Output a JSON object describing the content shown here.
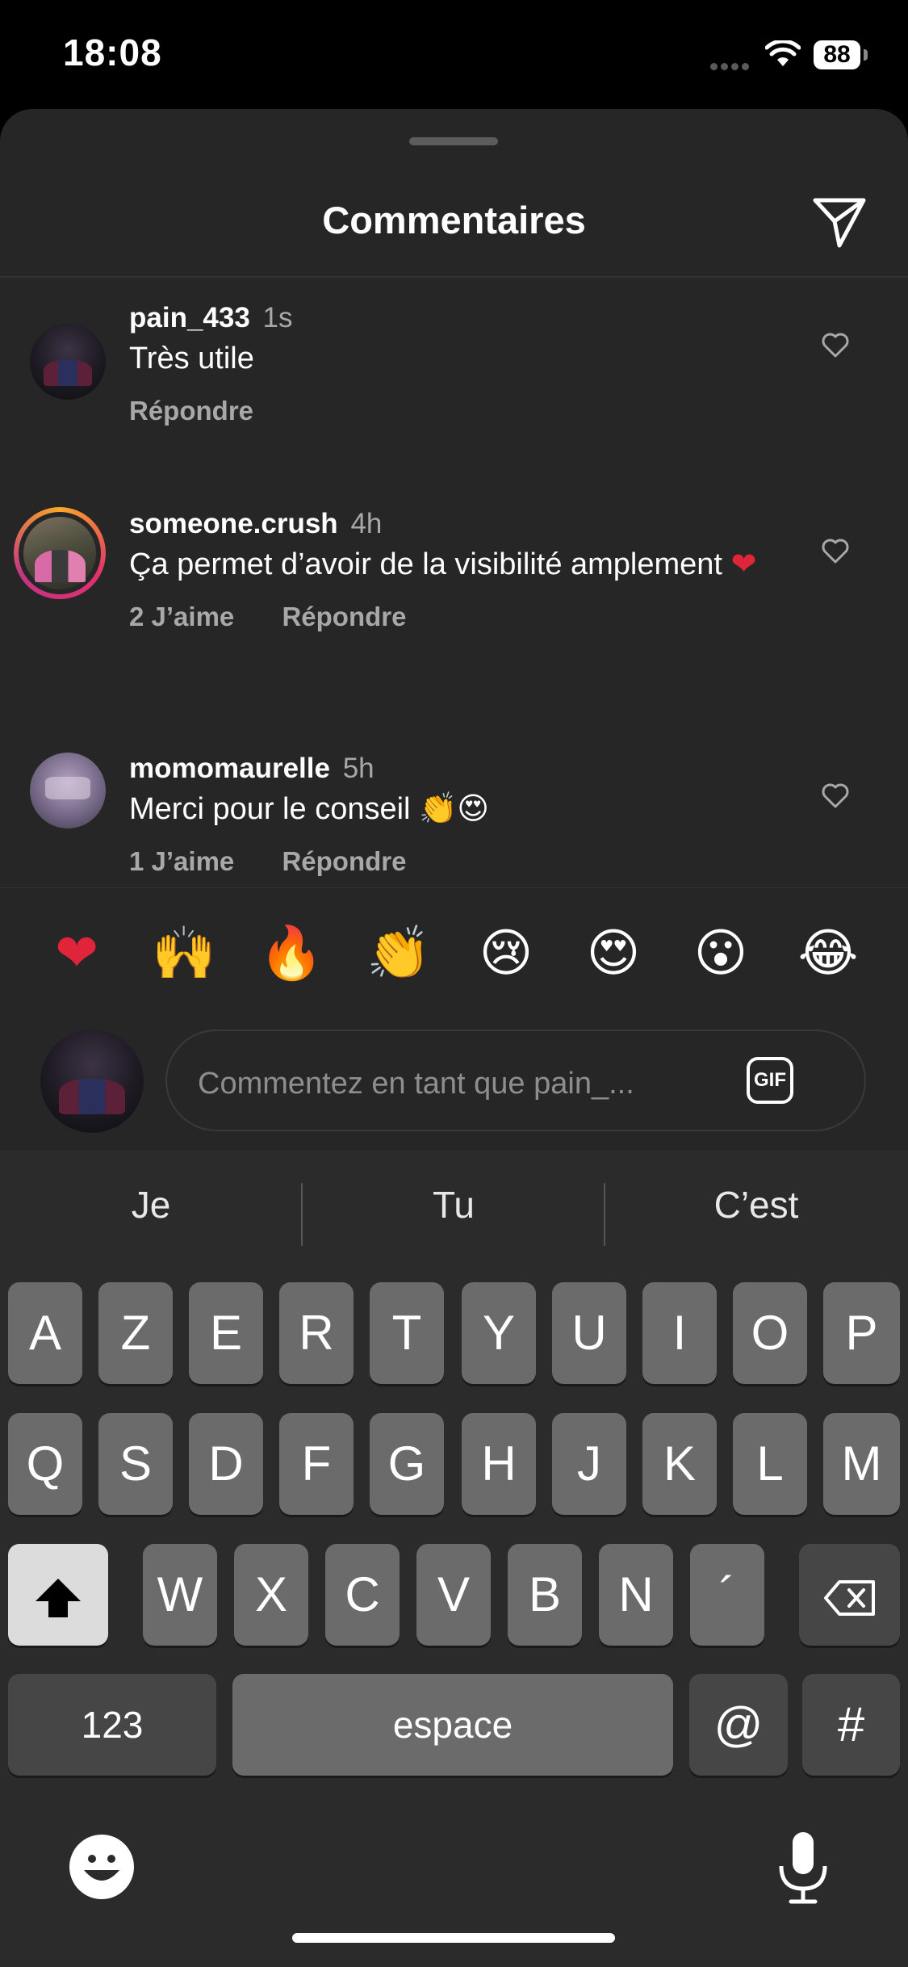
{
  "status_bar": {
    "time": "18:08",
    "battery": "88"
  },
  "sheet": {
    "title": "Commentaires"
  },
  "comments": [
    {
      "user": "pain_433",
      "time": "1s",
      "text": "Très utile",
      "likes": "",
      "reply": "Répondre"
    },
    {
      "user": "someone.crush",
      "time": "4h",
      "text": "Ça permet d’avoir de la visibilité amplement",
      "heart": "❤",
      "likes": "2 J’aime",
      "reply": "Répondre"
    },
    {
      "user": "momomaurelle",
      "time": "5h",
      "text": "Merci pour le conseil",
      "emojis": "👏😍",
      "likes": "1 J’aime",
      "reply": "Répondre"
    }
  ],
  "reactions": [
    "❤",
    "🙌",
    "🔥",
    "👏",
    "😢",
    "😍",
    "😮",
    "😂"
  ],
  "composer": {
    "placeholder": "Commentez en tant que pain_...",
    "gif_label": "GIF"
  },
  "keyboard": {
    "predictions": [
      "Je",
      "Tu",
      "C’est"
    ],
    "row1": [
      "A",
      "Z",
      "E",
      "R",
      "T",
      "Y",
      "U",
      "I",
      "O",
      "P"
    ],
    "row2": [
      "Q",
      "S",
      "D",
      "F",
      "G",
      "H",
      "J",
      "K",
      "L",
      "M"
    ],
    "row3": [
      "W",
      "X",
      "C",
      "V",
      "B",
      "N",
      "´"
    ],
    "numbers_key": "123",
    "space_key": "espace",
    "at_key": "@",
    "hash_key": "#"
  }
}
